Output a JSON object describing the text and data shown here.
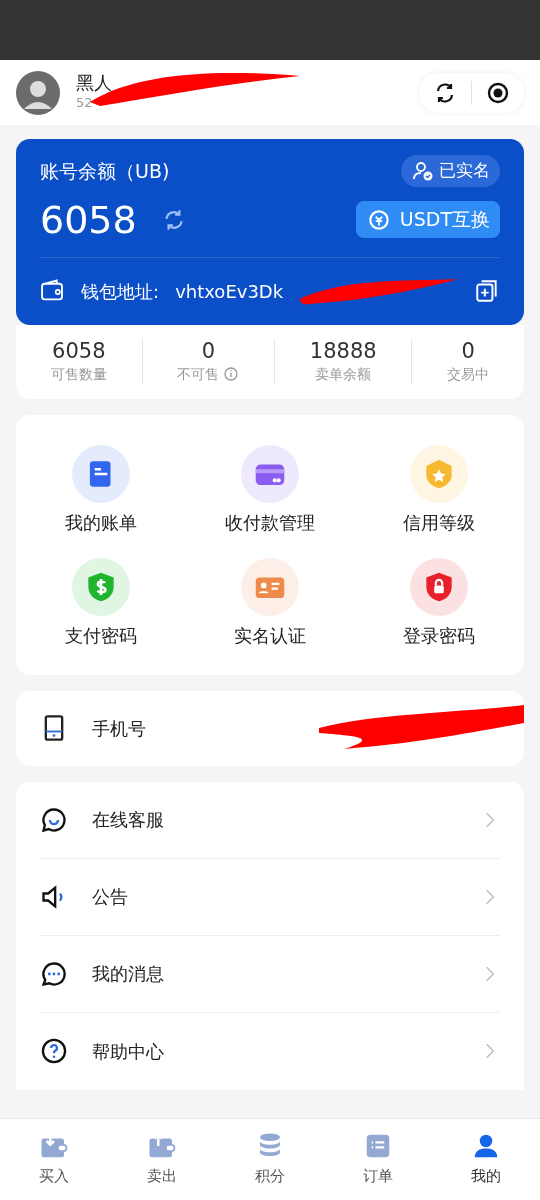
{
  "profile": {
    "name": "黑人",
    "user_id": "52"
  },
  "balance_card": {
    "title": "账号余额（UB)",
    "verified_badge": "已实名",
    "amount": "6058",
    "exchange_button": "USDT互换",
    "wallet_label": "钱包地址:",
    "wallet_address": "vhtxoEv3Dk"
  },
  "stats": [
    {
      "value": "6058",
      "label": "可售数量",
      "info": false
    },
    {
      "value": "0",
      "label": "不可售",
      "info": true
    },
    {
      "value": "18888",
      "label": "卖单余额",
      "info": false
    },
    {
      "value": "0",
      "label": "交易中",
      "info": false
    }
  ],
  "shortcuts": [
    {
      "label": "我的账单",
      "color": "#3366ee"
    },
    {
      "label": "收付款管理",
      "color": "#8a5cf0"
    },
    {
      "label": "信用等级",
      "color": "#f5b82e"
    },
    {
      "label": "支付密码",
      "color": "#1fb52f"
    },
    {
      "label": "实名认证",
      "color": "#ee8a4a"
    },
    {
      "label": "登录密码",
      "color": "#e8202a"
    }
  ],
  "phone_row": {
    "label": "手机号"
  },
  "menu": [
    {
      "label": "在线客服"
    },
    {
      "label": "公告"
    },
    {
      "label": "我的消息"
    },
    {
      "label": "帮助中心"
    }
  ],
  "tab_bar": [
    {
      "label": "买入",
      "selected": false
    },
    {
      "label": "卖出",
      "selected": false
    },
    {
      "label": "积分",
      "selected": false
    },
    {
      "label": "订单",
      "selected": false
    },
    {
      "label": "我的",
      "selected": true
    }
  ]
}
